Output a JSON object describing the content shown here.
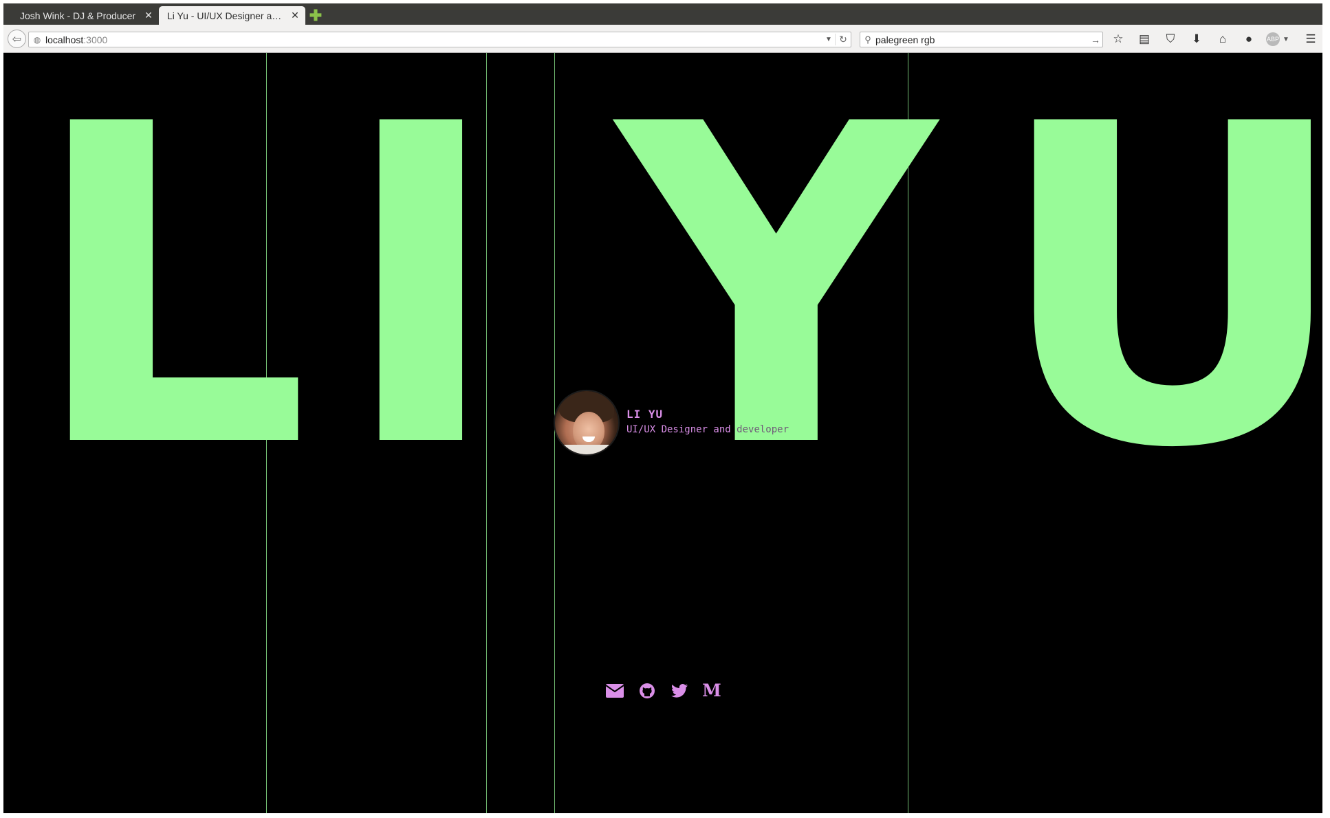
{
  "browser": {
    "tabs": [
      {
        "title": "Josh Wink - DJ & Producer",
        "active": false
      },
      {
        "title": "Li Yu - UI/UX Designer a…",
        "active": true
      }
    ],
    "url_host": "localhost",
    "url_port": ":3000",
    "search_text": "palegreen rgb",
    "toolbar_icons": [
      "bookmark-star-icon",
      "reading-list-icon",
      "pocket-icon",
      "download-icon",
      "home-icon",
      "chat-icon",
      "adblock-icon",
      "menu-icon"
    ],
    "abp_label": "ABP"
  },
  "page": {
    "accent_color": "#98fb98",
    "text_color": "#da8fe8",
    "background": "#000000",
    "hero_letters": [
      "L",
      "I",
      "Y",
      "U"
    ],
    "profile": {
      "name": "LI YU",
      "role_prefix": "UI/UX Designer and ",
      "role_suffix": "developer"
    },
    "social_links": [
      "email-icon",
      "github-icon",
      "twitter-icon",
      "medium-icon"
    ],
    "medium_glyph": "M"
  }
}
